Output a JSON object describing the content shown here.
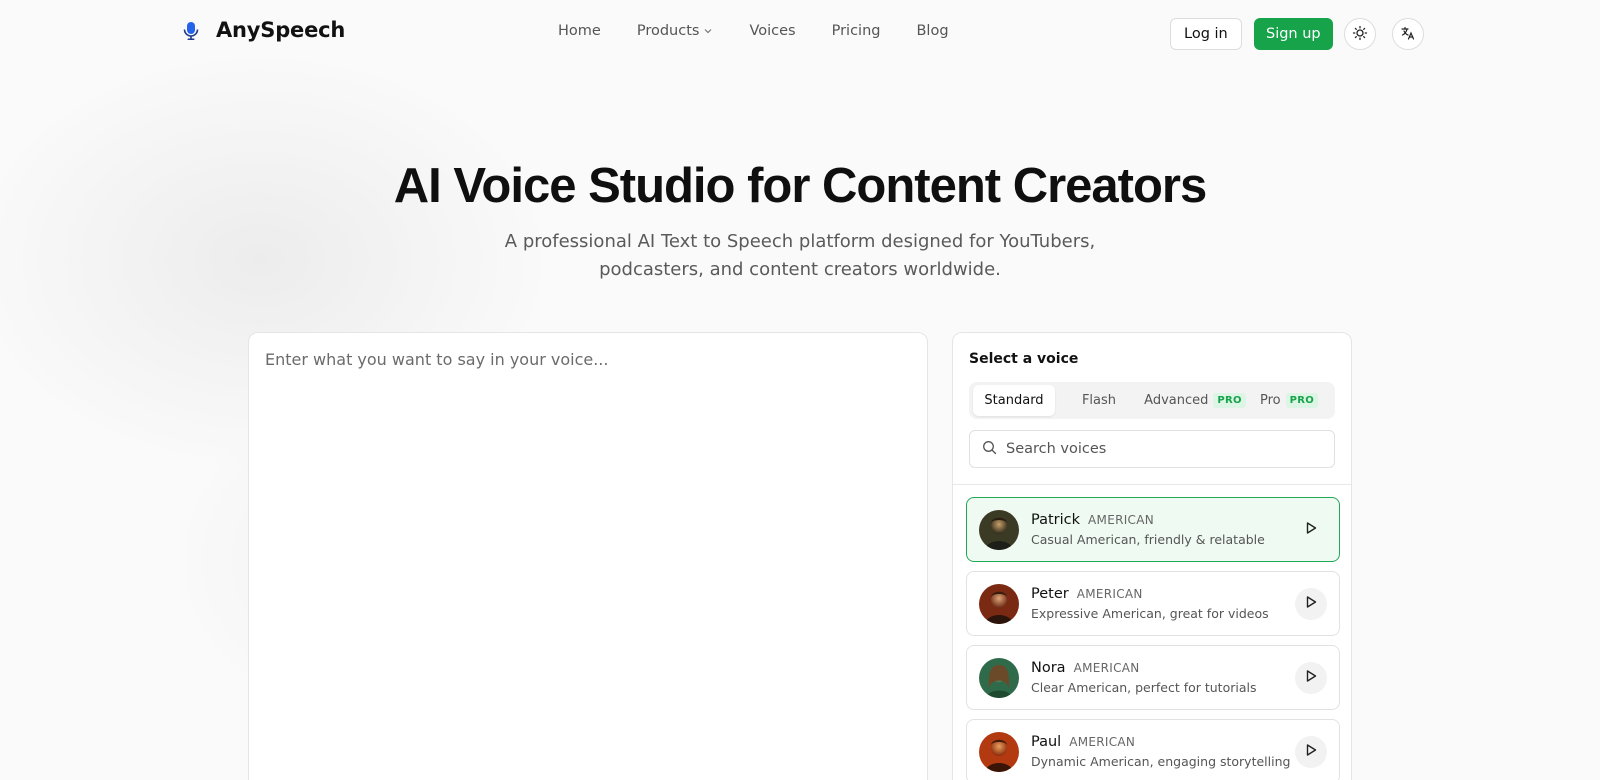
{
  "brand": {
    "name": "AnySpeech"
  },
  "nav": {
    "items": [
      {
        "label": "Home",
        "has_dropdown": false
      },
      {
        "label": "Products",
        "has_dropdown": true
      },
      {
        "label": "Voices",
        "has_dropdown": false
      },
      {
        "label": "Pricing",
        "has_dropdown": false
      },
      {
        "label": "Blog",
        "has_dropdown": false
      }
    ]
  },
  "auth": {
    "login_label": "Log in",
    "signup_label": "Sign up"
  },
  "icons": {
    "theme_toggle": "sun-icon",
    "language": "translate-icon"
  },
  "colors": {
    "accent": "#16a34a",
    "accent_bg": "#dcf5e4",
    "selected_bg": "#effaf2",
    "selected_border": "#22a855"
  },
  "hero": {
    "title": "AI Voice Studio for Content Creators",
    "subtitle": "A professional AI Text to Speech platform designed for YouTubers, podcasters, and content creators worldwide."
  },
  "editor": {
    "placeholder": "Enter what you want to say in your voice..."
  },
  "voice_panel": {
    "title": "Select a voice",
    "tabs": [
      {
        "label": "Standard",
        "badge": "",
        "active": true
      },
      {
        "label": "Flash",
        "badge": "",
        "active": false
      },
      {
        "label": "Advanced",
        "badge": "PRO",
        "active": false
      },
      {
        "label": "Pro",
        "badge": "PRO",
        "active": false
      }
    ],
    "search_placeholder": "Search voices",
    "voices": [
      {
        "name": "Patrick",
        "accent": "AMERICAN",
        "description": "Casual American, friendly & relatable",
        "selected": true
      },
      {
        "name": "Peter",
        "accent": "AMERICAN",
        "description": "Expressive American, great for videos",
        "selected": false
      },
      {
        "name": "Nora",
        "accent": "AMERICAN",
        "description": "Clear American, perfect for tutorials",
        "selected": false
      },
      {
        "name": "Paul",
        "accent": "AMERICAN",
        "description": "Dynamic American, engaging storytelling",
        "selected": false
      }
    ]
  }
}
